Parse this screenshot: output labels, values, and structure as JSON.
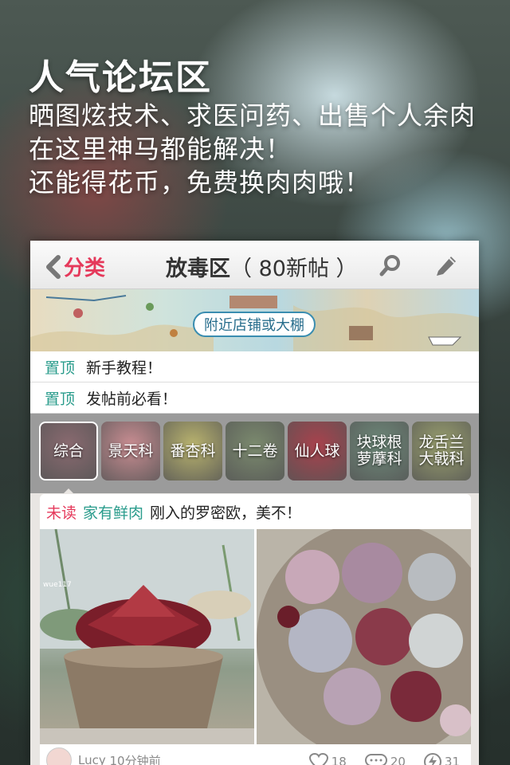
{
  "promo": {
    "title": "人气论坛区",
    "line1": "晒图炫技术、求医问药、出售个人余肉",
    "line2": "在这里神马都能解决！",
    "line3": "还能得花币，免费换肉肉哦！"
  },
  "navbar": {
    "back_label": "分类",
    "title_main": "放毒区",
    "title_count": "（ 80新帖 ）",
    "search_icon": "search-icon",
    "edit_icon": "edit-icon"
  },
  "banner": {
    "label": "附近店铺或大棚"
  },
  "pinned": [
    {
      "tag": "置顶",
      "text": "新手教程！"
    },
    {
      "tag": "置顶",
      "text": "发帖前必看！"
    }
  ],
  "categories": [
    {
      "label": "综合",
      "active": true,
      "color": "#8a6a70"
    },
    {
      "label": "景天科",
      "active": false,
      "color": "#c98d92"
    },
    {
      "label": "番杏科",
      "active": false,
      "color": "#b9b36e"
    },
    {
      "label": "十二卷",
      "active": false,
      "color": "#7b8a6e"
    },
    {
      "label": "仙人球",
      "active": false,
      "color": "#a8424d"
    },
    {
      "label": "块球根\n萝藦科",
      "active": false,
      "color": "#6e8a7a"
    },
    {
      "label": "龙舌兰\n大戟科",
      "active": false,
      "color": "#9aa06e"
    }
  ],
  "post": {
    "unread_tag": "未读",
    "board": "家有鲜肉",
    "title": "刚入的罗密欧，美不！",
    "watermark": "wue117",
    "author": "Lucy",
    "time": "10分钟前",
    "likes": "18",
    "comments": "20",
    "shares": "31"
  },
  "colors": {
    "accent_red": "#e5395b",
    "accent_teal": "#2a9c8c"
  }
}
